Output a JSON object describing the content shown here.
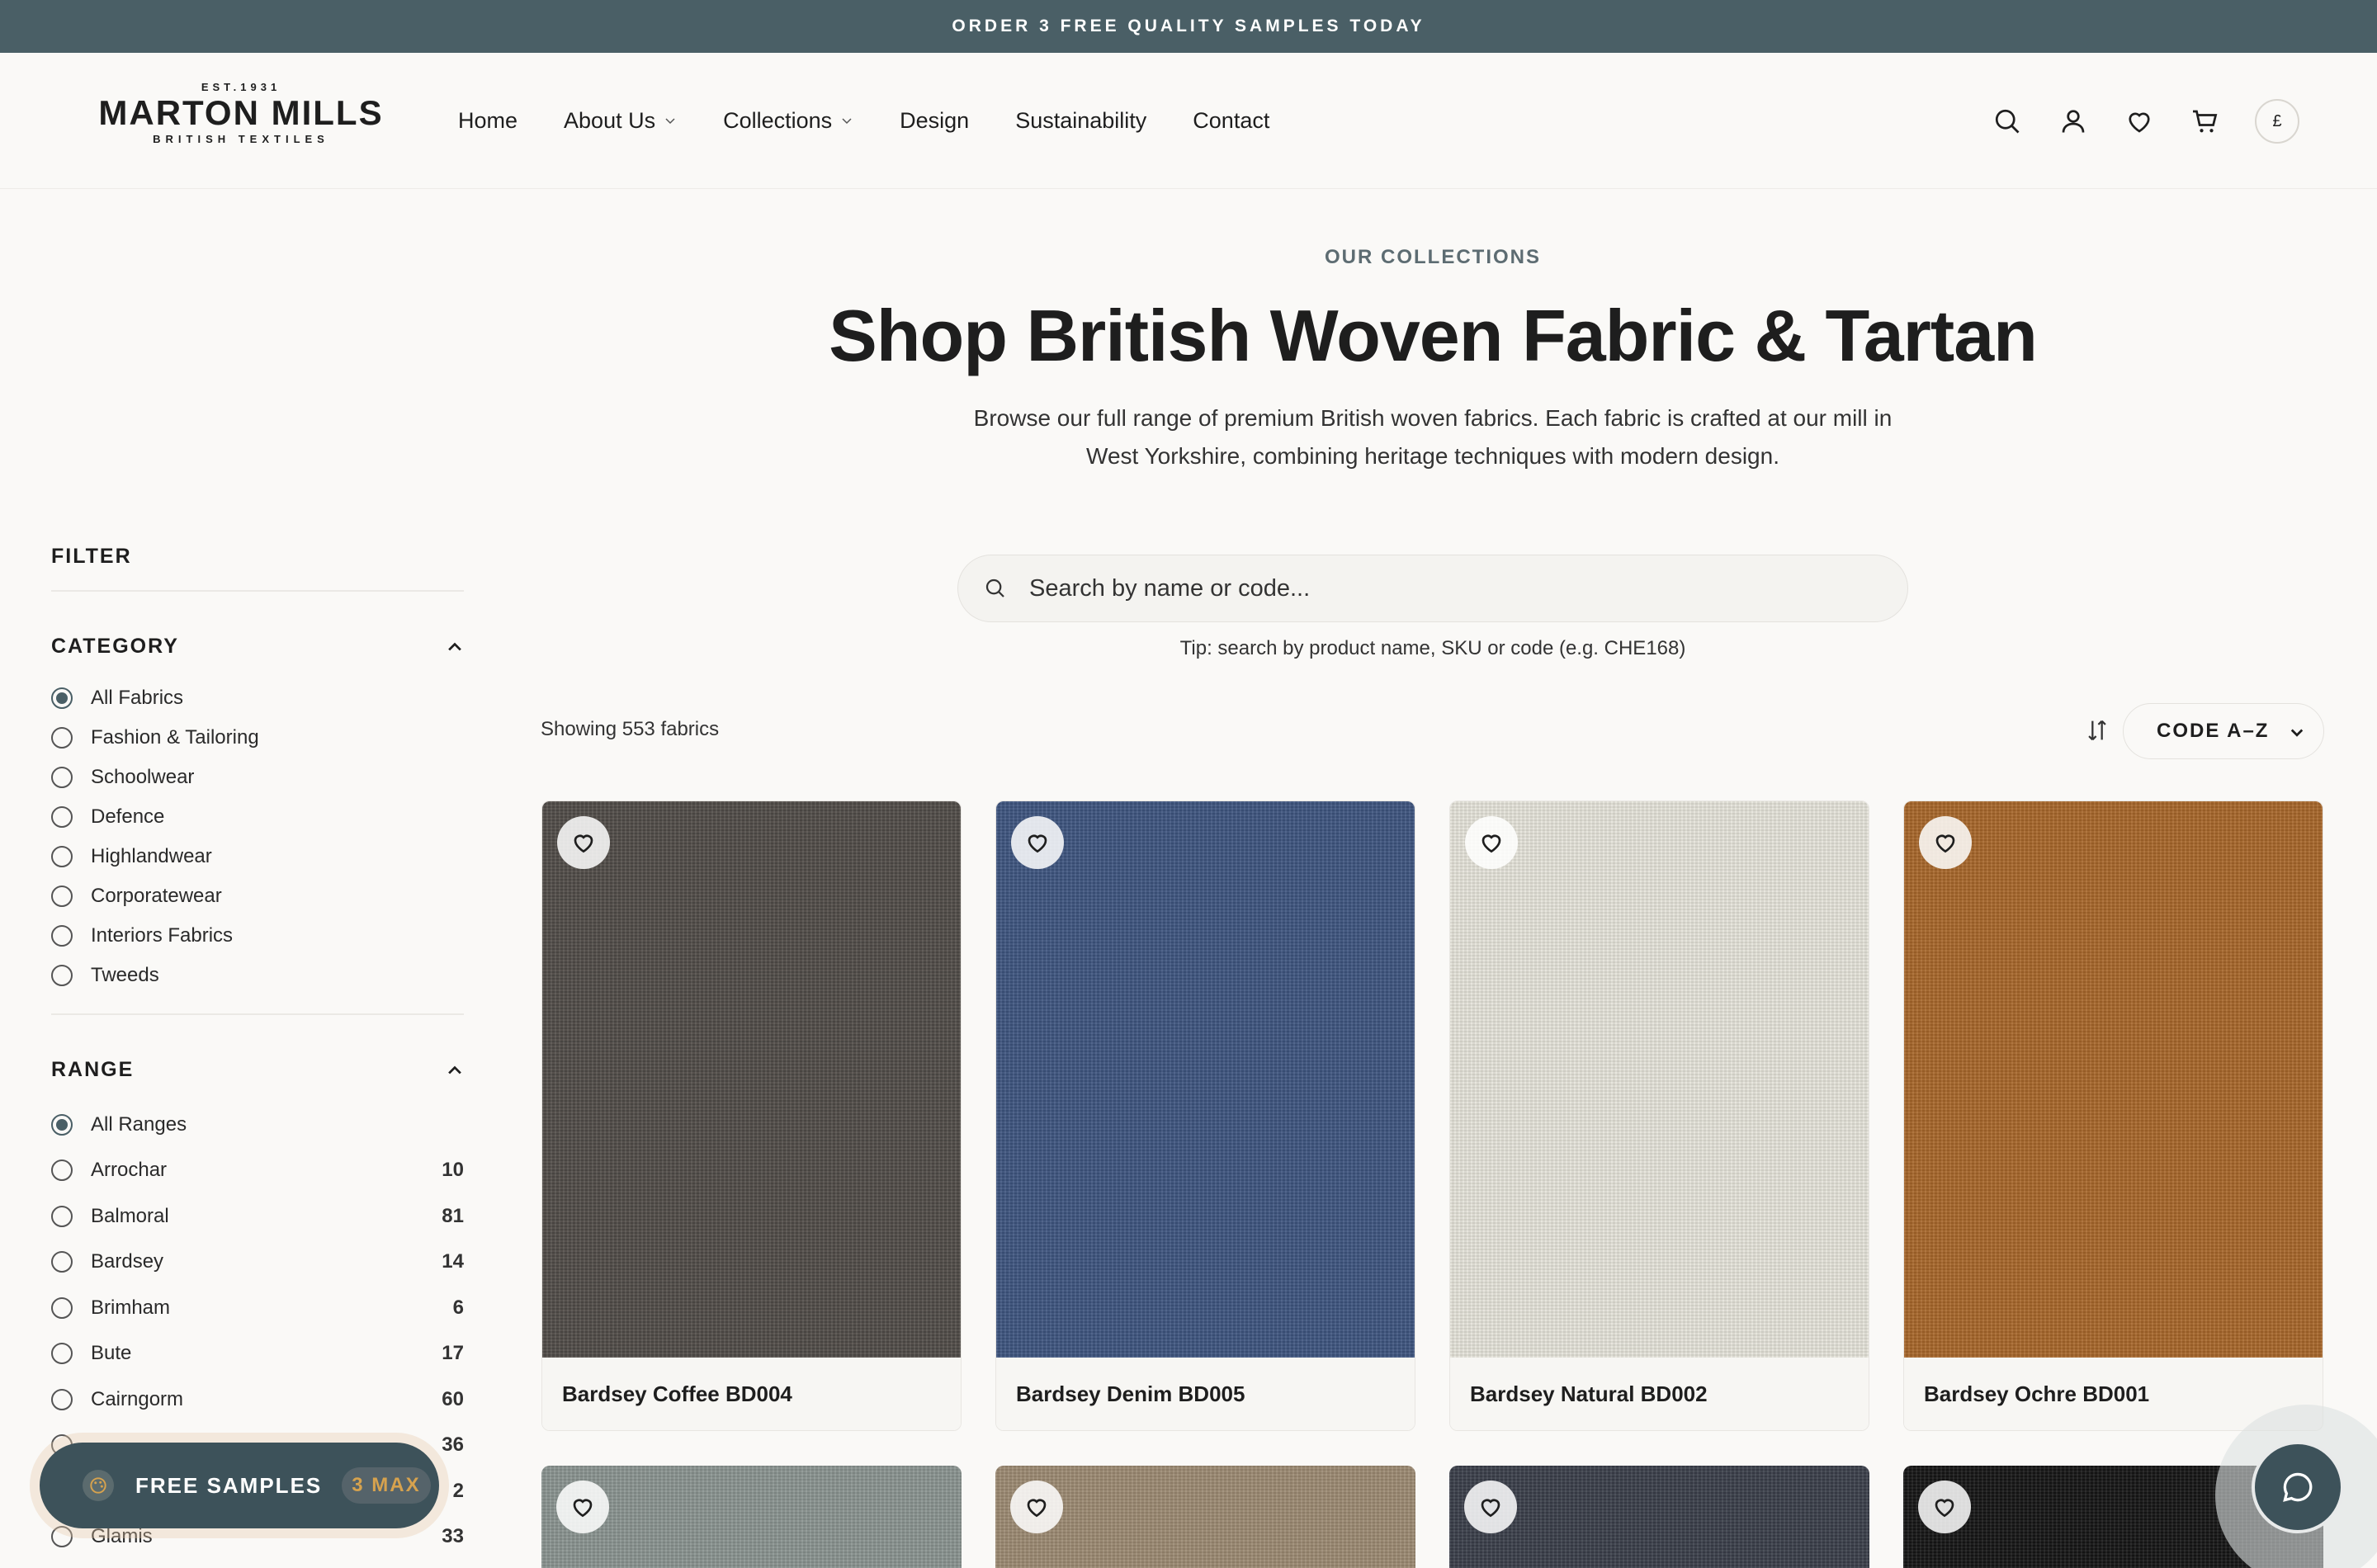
{
  "banner": {
    "text": "ORDER 3 FREE QUALITY SAMPLES TODAY"
  },
  "logo": {
    "est": "EST.1931",
    "name": "MARTON MILLS",
    "sub": "BRITISH TEXTILES"
  },
  "nav": [
    {
      "label": "Home",
      "dropdown": false
    },
    {
      "label": "About Us",
      "dropdown": true
    },
    {
      "label": "Collections",
      "dropdown": true
    },
    {
      "label": "Design",
      "dropdown": false
    },
    {
      "label": "Sustainability",
      "dropdown": false
    },
    {
      "label": "Contact",
      "dropdown": false
    }
  ],
  "header_icons": [
    "search-icon",
    "account-icon",
    "wishlist-icon",
    "cart-icon"
  ],
  "currency": "£",
  "hero": {
    "eyebrow": "OUR COLLECTIONS",
    "title": "Shop British Woven Fabric & Tartan",
    "desc_line1": "Browse our full range of premium British woven fabrics. Each fabric is crafted at our mill in",
    "desc_line2": "West Yorkshire, combining heritage techniques with modern design."
  },
  "search": {
    "placeholder": "Search by name or code...",
    "tip": "Tip: search by product name, SKU or code (e.g. CHE168)"
  },
  "filter": {
    "title": "FILTER",
    "category": {
      "title": "CATEGORY",
      "options": [
        {
          "label": "All Fabrics",
          "checked": true
        },
        {
          "label": "Fashion & Tailoring",
          "checked": false
        },
        {
          "label": "Schoolwear",
          "checked": false
        },
        {
          "label": "Defence",
          "checked": false
        },
        {
          "label": "Highlandwear",
          "checked": false
        },
        {
          "label": "Corporatewear",
          "checked": false
        },
        {
          "label": "Interiors Fabrics",
          "checked": false
        },
        {
          "label": "Tweeds",
          "checked": false
        }
      ]
    },
    "range": {
      "title": "RANGE",
      "options": [
        {
          "label": "All Ranges",
          "count": "",
          "checked": true
        },
        {
          "label": "Arrochar",
          "count": "10",
          "checked": false
        },
        {
          "label": "Balmoral",
          "count": "81",
          "checked": false
        },
        {
          "label": "Bardsey",
          "count": "14",
          "checked": false
        },
        {
          "label": "Brimham",
          "count": "6",
          "checked": false
        },
        {
          "label": "Bute",
          "count": "17",
          "checked": false
        },
        {
          "label": "Cairngorm",
          "count": "60",
          "checked": false
        },
        {
          "label": "",
          "count": "36",
          "checked": false
        },
        {
          "label": "",
          "count": "2",
          "checked": false
        },
        {
          "label": "Glamis",
          "count": "33",
          "checked": false
        }
      ]
    }
  },
  "results": {
    "showing": "Showing 553 fabrics",
    "sort": "CODE A–Z"
  },
  "products": [
    {
      "name": "Bardsey Coffee BD004",
      "color": "#514c48"
    },
    {
      "name": "Bardsey Denim BD005",
      "color": "#3e5580"
    },
    {
      "name": "Bardsey Natural BD002",
      "color": "#e6e4da"
    },
    {
      "name": "Bardsey Ochre BD001",
      "color": "#a8672a"
    }
  ],
  "products_row2": [
    {
      "color": "#8a9490"
    },
    {
      "color": "#9c8a72"
    },
    {
      "color": "#3a3f4a"
    },
    {
      "color": "#151515"
    }
  ],
  "samples": {
    "label": "FREE SAMPLES",
    "max": "3 MAX"
  }
}
